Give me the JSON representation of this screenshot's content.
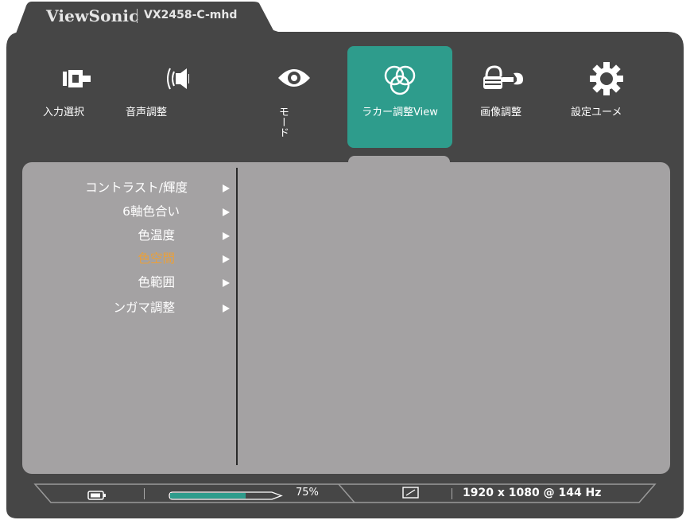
{
  "header": {
    "brand": "ViewSonic",
    "model": "VX2458-C-mhd"
  },
  "menu": {
    "items": [
      {
        "label": "入力選択",
        "icon": "input-source-icon"
      },
      {
        "label": "音声調整",
        "icon": "speaker-icon"
      },
      {
        "label": "モード",
        "icon": "eye-icon"
      },
      {
        "label": "ラカー調整View",
        "icon": "color-circles-icon",
        "selected": true
      },
      {
        "label": "画像調整",
        "icon": "hand-wrench-icon"
      },
      {
        "label": "設定ユーメ",
        "icon": "gear-icon"
      }
    ]
  },
  "submenu": {
    "items": [
      {
        "label": "コントラスト/輝度"
      },
      {
        "label": "6軸色合い"
      },
      {
        "label": "色温度"
      },
      {
        "label": "色空間",
        "active": true
      },
      {
        "label": "色範囲"
      },
      {
        "label": "ンガマ調整"
      }
    ]
  },
  "status": {
    "battery_icon": "battery-icon",
    "progress_percent": 75,
    "progress_label": "75%",
    "aspect_icon": "aspect-ratio-icon",
    "resolution": "1920 x 1080 @ 144 Hz"
  },
  "colors": {
    "osd_bg": "#464646",
    "panel_bg": "#a4a2a3",
    "accent": "#2e9c8c",
    "active_text": "#e9a03b"
  }
}
